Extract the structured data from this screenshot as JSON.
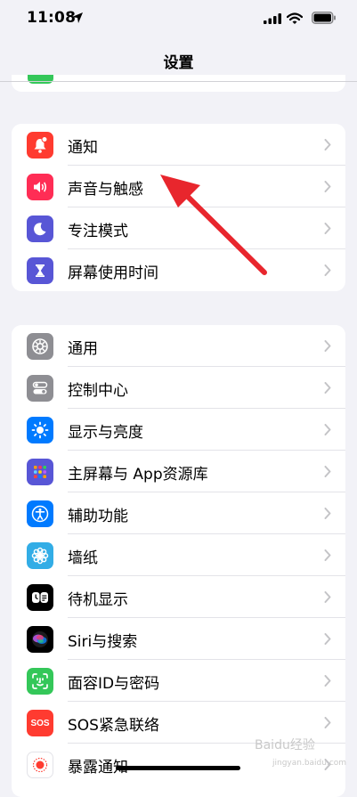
{
  "status": {
    "time": "11:08"
  },
  "nav": {
    "title": "设置"
  },
  "group1": [
    {
      "label": "通知",
      "icon": "bell-badge-icon",
      "color": "#ff3b30"
    },
    {
      "label": "声音与触感",
      "icon": "speaker-icon",
      "color": "#ff2d55"
    },
    {
      "label": "专注模式",
      "icon": "moon-icon",
      "color": "#5856d6"
    },
    {
      "label": "屏幕使用时间",
      "icon": "hourglass-icon",
      "color": "#5856d6"
    }
  ],
  "group2": [
    {
      "label": "通用",
      "icon": "gear-icon",
      "color": "#8e8e93"
    },
    {
      "label": "控制中心",
      "icon": "toggles-icon",
      "color": "#8e8e93"
    },
    {
      "label": "显示与亮度",
      "icon": "sun-icon",
      "color": "#007aff"
    },
    {
      "label": "主屏幕与 App资源库",
      "icon": "app-grid-icon",
      "color": "#5856d6"
    },
    {
      "label": "辅助功能",
      "icon": "accessibility-icon",
      "color": "#007aff"
    },
    {
      "label": "墙纸",
      "icon": "flower-icon",
      "color": "#32ade6"
    },
    {
      "label": "待机显示",
      "icon": "standby-icon",
      "color": "#000000"
    },
    {
      "label": "Siri与搜索",
      "icon": "siri-icon",
      "color": "#000000"
    },
    {
      "label": "面容ID与密码",
      "icon": "face-id-icon",
      "color": "#34c759"
    },
    {
      "label": "SOS紧急联络",
      "icon": "sos-icon",
      "color": "#ff3b30"
    },
    {
      "label": "暴露通知",
      "icon": "exposure-icon",
      "color": "#ffffff"
    }
  ],
  "icon_text": {
    "sos": "SOS"
  },
  "watermark": {
    "line1": "Baidu经验",
    "line2": "jingyan.baidu.com"
  }
}
